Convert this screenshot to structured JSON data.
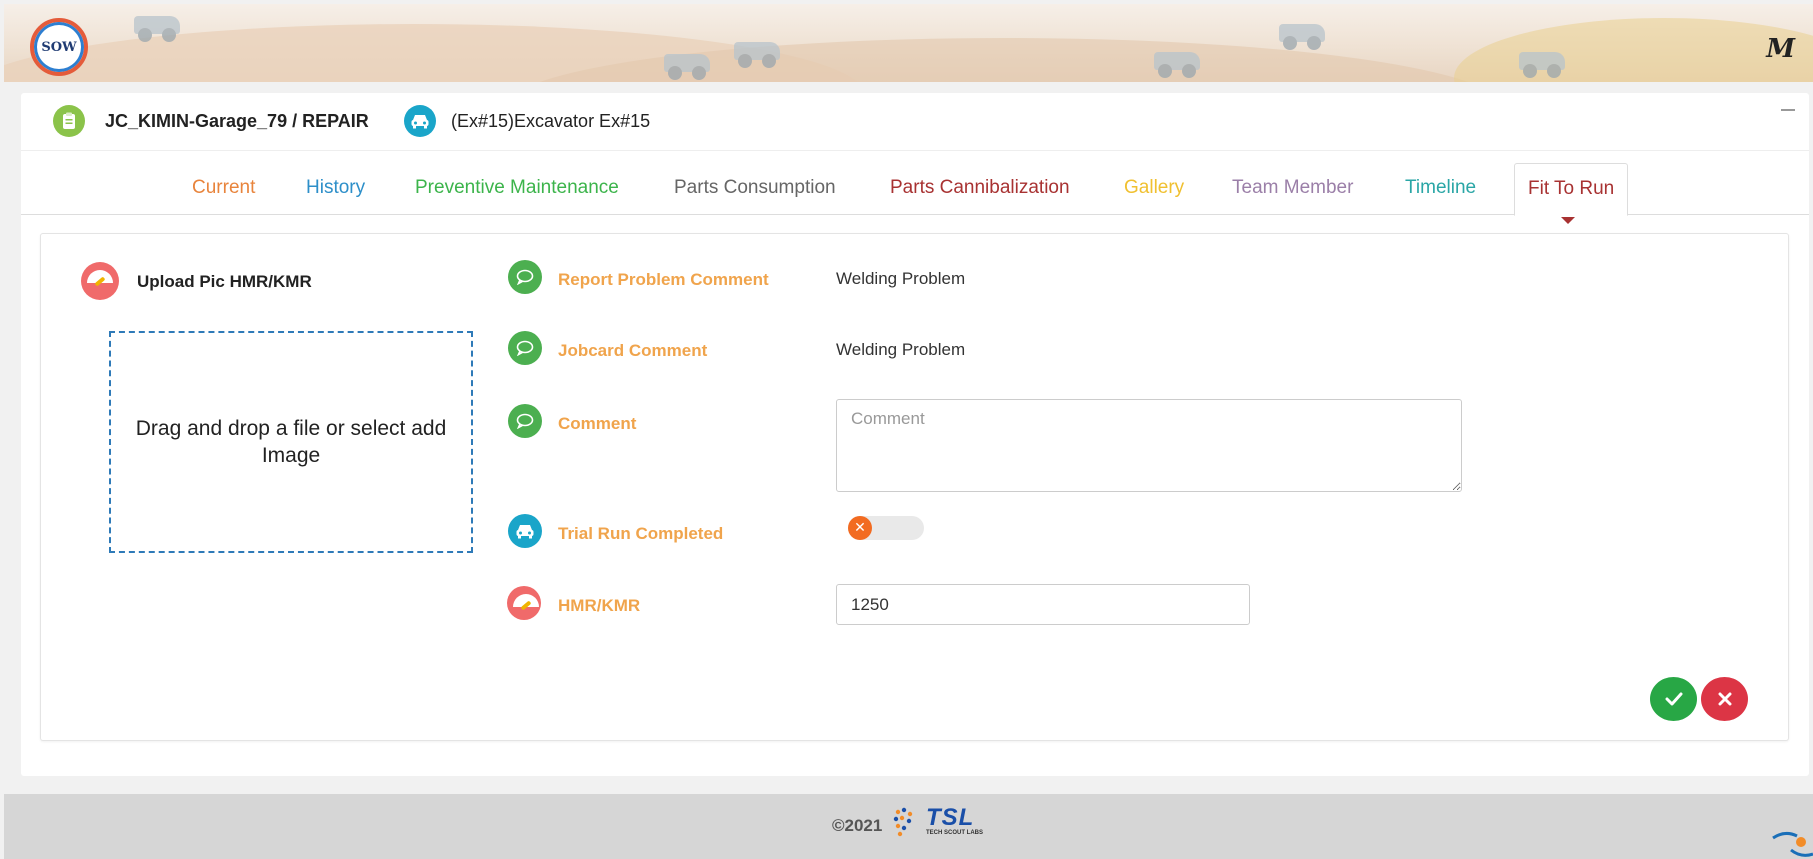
{
  "banner": {
    "logo_text": "SOW",
    "brand_mark": "M"
  },
  "header": {
    "jobcard_title": "JC_KIMIN-Garage_79 / REPAIR",
    "vehicle_title": "(Ex#15)Excavator Ex#15"
  },
  "tabs": [
    {
      "label": "Current",
      "color": "#e8843c"
    },
    {
      "label": "History",
      "color": "#2d8fc9"
    },
    {
      "label": "Preventive Maintenance",
      "color": "#3cb44b"
    },
    {
      "label": "Parts Consumption",
      "color": "#666666"
    },
    {
      "label": "Parts Cannibalization",
      "color": "#a83232"
    },
    {
      "label": "Gallery",
      "color": "#f0c030"
    },
    {
      "label": "Team Member",
      "color": "#9b7fa8"
    },
    {
      "label": "Timeline",
      "color": "#2aa6a6"
    },
    {
      "label": "Fit To Run",
      "color": "#a83232",
      "active": true
    }
  ],
  "upload": {
    "label": "Upload Pic HMR/KMR",
    "dropzone_text": "Drag and drop a file or select add Image"
  },
  "fields": {
    "report_problem_label": "Report Problem Comment",
    "report_problem_value": "Welding Problem",
    "jobcard_comment_label": "Jobcard Comment",
    "jobcard_comment_value": "Welding Problem",
    "comment_label": "Comment",
    "comment_placeholder": "Comment",
    "trial_run_label": "Trial Run Completed",
    "trial_run_value": false,
    "hmr_label": "HMR/KMR",
    "hmr_value": "1250"
  },
  "footer": {
    "copyright": "©2021",
    "brand": "TSL",
    "brand_sub": "TECH SCOUT LABS"
  },
  "colors": {
    "label_orange": "#f0a44c",
    "accept_green": "#28a745",
    "reject_red": "#dc3545",
    "toggle_off": "#f26b21"
  }
}
